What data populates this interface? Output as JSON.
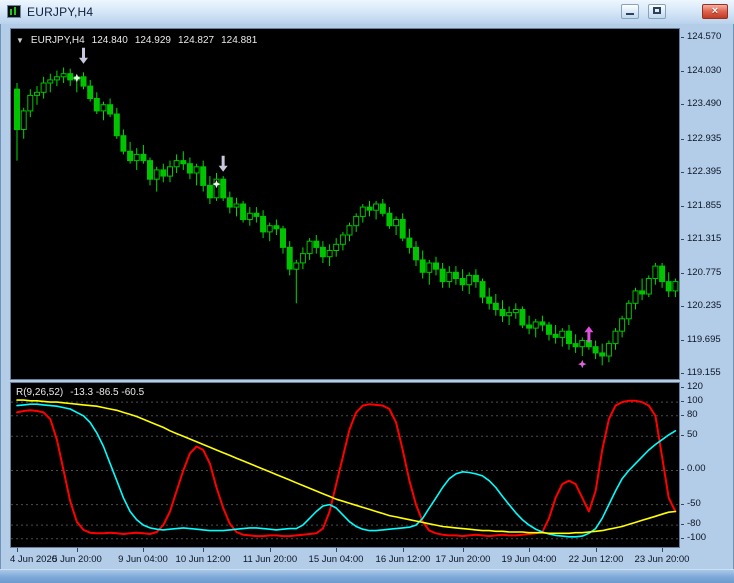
{
  "window": {
    "title": "EURJPY,H4",
    "close_glyph": "×"
  },
  "chart_header": {
    "dropdown_glyph": "▼",
    "symbol": "EURJPY,H4",
    "open": "124.840",
    "high": "124.929",
    "low": "124.827",
    "close": "124.881"
  },
  "indicator_header": {
    "name": "R(9,26,52)",
    "values": "-13.3 -86.5 -60.5"
  },
  "chart_data": [
    {
      "type": "candlestick",
      "symbol": "EURJPY",
      "timeframe": "H4",
      "colors": {
        "body": "#00C400",
        "wick": "#00DC00",
        "background": "#000000"
      },
      "axis": {
        "top_price": 124.72,
        "bottom_price": 119.08,
        "labels": [
          "124.570",
          "124.030",
          "123.490",
          "122.935",
          "122.395",
          "121.855",
          "121.315",
          "120.775",
          "120.235",
          "119.695",
          "119.155"
        ]
      },
      "x_axis": {
        "labels": [
          "4 Jun 2020",
          "5 Jun 20:00",
          "9 Jun 04:00",
          "10 Jun 12:00",
          "11 Jun 20:00",
          "15 Jun 04:00",
          "16 Jun 12:00",
          "17 Jun 20:00",
          "19 Jun 04:00",
          "22 Jun 12:00",
          "23 Jun 20:00"
        ],
        "bars": [
          0,
          9,
          19,
          28,
          38,
          48,
          58,
          67,
          77,
          87,
          97
        ]
      },
      "candles": [
        [
          123.75,
          123.85,
          122.6,
          123.1
        ],
        [
          123.1,
          123.45,
          122.95,
          123.4
        ],
        [
          123.4,
          123.75,
          123.3,
          123.65
        ],
        [
          123.65,
          123.8,
          123.5,
          123.7
        ],
        [
          123.7,
          123.95,
          123.6,
          123.85
        ],
        [
          123.85,
          124.0,
          123.7,
          123.9
        ],
        [
          123.9,
          124.05,
          123.8,
          123.95
        ],
        [
          123.95,
          124.1,
          123.85,
          124.0
        ],
        [
          124.0,
          124.08,
          123.8,
          123.9
        ],
        [
          123.9,
          123.98,
          123.7,
          123.95
        ],
        [
          123.95,
          124.02,
          123.75,
          123.8
        ],
        [
          123.8,
          123.9,
          123.55,
          123.6
        ],
        [
          123.6,
          123.7,
          123.35,
          123.4
        ],
        [
          123.4,
          123.55,
          123.25,
          123.5
        ],
        [
          123.5,
          123.6,
          123.3,
          123.35
        ],
        [
          123.35,
          123.45,
          122.95,
          123.0
        ],
        [
          123.0,
          123.1,
          122.7,
          122.75
        ],
        [
          122.75,
          122.9,
          122.55,
          122.6
        ],
        [
          122.6,
          122.8,
          122.45,
          122.7
        ],
        [
          122.7,
          122.85,
          122.55,
          122.6
        ],
        [
          122.6,
          122.65,
          122.2,
          122.3
        ],
        [
          122.3,
          122.5,
          122.1,
          122.45
        ],
        [
          122.45,
          122.55,
          122.25,
          122.35
        ],
        [
          122.35,
          122.6,
          122.25,
          122.5
        ],
        [
          122.5,
          122.7,
          122.4,
          122.6
        ],
        [
          122.6,
          122.75,
          122.45,
          122.55
        ],
        [
          122.55,
          122.65,
          122.3,
          122.4
        ],
        [
          122.4,
          122.55,
          122.2,
          122.5
        ],
        [
          122.5,
          122.6,
          122.1,
          122.2
        ],
        [
          122.2,
          122.35,
          121.9,
          122.0
        ],
        [
          122.0,
          122.4,
          121.95,
          122.3
        ],
        [
          122.3,
          122.35,
          121.95,
          122.0
        ],
        [
          122.0,
          122.1,
          121.75,
          121.85
        ],
        [
          121.85,
          122.0,
          121.7,
          121.9
        ],
        [
          121.9,
          121.95,
          121.6,
          121.65
        ],
        [
          121.65,
          121.85,
          121.55,
          121.75
        ],
        [
          121.75,
          121.85,
          121.6,
          121.7
        ],
        [
          121.7,
          121.8,
          121.35,
          121.45
        ],
        [
          121.45,
          121.6,
          121.3,
          121.55
        ],
        [
          121.55,
          121.65,
          121.4,
          121.5
        ],
        [
          121.5,
          121.55,
          121.1,
          121.2
        ],
        [
          121.2,
          121.3,
          120.75,
          120.85
        ],
        [
          120.85,
          121.0,
          120.3,
          120.95
        ],
        [
          120.95,
          121.2,
          120.85,
          121.1
        ],
        [
          121.1,
          121.35,
          121.0,
          121.3
        ],
        [
          121.3,
          121.4,
          121.1,
          121.2
        ],
        [
          121.2,
          121.3,
          120.95,
          121.05
        ],
        [
          121.05,
          121.25,
          120.9,
          121.15
        ],
        [
          121.15,
          121.35,
          121.05,
          121.25
        ],
        [
          121.25,
          121.45,
          121.15,
          121.4
        ],
        [
          121.4,
          121.6,
          121.3,
          121.55
        ],
        [
          121.55,
          121.75,
          121.45,
          121.7
        ],
        [
          121.7,
          121.9,
          121.6,
          121.85
        ],
        [
          121.85,
          121.95,
          121.7,
          121.8
        ],
        [
          121.8,
          121.95,
          121.65,
          121.9
        ],
        [
          121.9,
          121.98,
          121.7,
          121.75
        ],
        [
          121.75,
          121.85,
          121.5,
          121.55
        ],
        [
          121.55,
          121.7,
          121.4,
          121.65
        ],
        [
          121.65,
          121.75,
          121.3,
          121.35
        ],
        [
          121.35,
          121.5,
          121.1,
          121.2
        ],
        [
          121.2,
          121.3,
          120.9,
          121.0
        ],
        [
          121.0,
          121.15,
          120.7,
          120.8
        ],
        [
          120.8,
          121.0,
          120.6,
          120.95
        ],
        [
          120.95,
          121.05,
          120.75,
          120.85
        ],
        [
          120.85,
          120.95,
          120.55,
          120.65
        ],
        [
          120.65,
          120.9,
          120.55,
          120.8
        ],
        [
          120.8,
          120.9,
          120.6,
          120.7
        ],
        [
          120.7,
          120.85,
          120.5,
          120.6
        ],
        [
          120.6,
          120.8,
          120.45,
          120.75
        ],
        [
          120.75,
          120.85,
          120.55,
          120.65
        ],
        [
          120.65,
          120.7,
          120.3,
          120.4
        ],
        [
          120.4,
          120.55,
          120.2,
          120.3
        ],
        [
          120.3,
          120.45,
          120.1,
          120.2
        ],
        [
          120.2,
          120.35,
          120.0,
          120.1
        ],
        [
          120.1,
          120.25,
          119.95,
          120.15
        ],
        [
          120.15,
          120.3,
          120.05,
          120.2
        ],
        [
          120.2,
          120.25,
          119.9,
          119.95
        ],
        [
          119.95,
          120.1,
          119.8,
          119.9
        ],
        [
          119.9,
          120.05,
          119.75,
          120.0
        ],
        [
          120.0,
          120.1,
          119.85,
          119.95
        ],
        [
          119.95,
          120.0,
          119.7,
          119.8
        ],
        [
          119.8,
          119.95,
          119.65,
          119.75
        ],
        [
          119.75,
          119.9,
          119.6,
          119.85
        ],
        [
          119.85,
          119.95,
          119.55,
          119.65
        ],
        [
          119.65,
          119.8,
          119.5,
          119.6
        ],
        [
          119.6,
          119.75,
          119.45,
          119.7
        ],
        [
          119.7,
          119.8,
          119.55,
          119.6
        ],
        [
          119.6,
          119.7,
          119.4,
          119.5
        ],
        [
          119.5,
          119.65,
          119.3,
          119.45
        ],
        [
          119.45,
          119.7,
          119.35,
          119.65
        ],
        [
          119.65,
          119.9,
          119.55,
          119.85
        ],
        [
          119.85,
          120.1,
          119.75,
          120.05
        ],
        [
          120.05,
          120.35,
          119.95,
          120.3
        ],
        [
          120.3,
          120.55,
          120.2,
          120.5
        ],
        [
          120.5,
          120.7,
          120.35,
          120.45
        ],
        [
          120.45,
          120.75,
          120.4,
          120.7
        ],
        [
          120.7,
          120.95,
          120.6,
          120.9
        ],
        [
          120.9,
          120.95,
          120.55,
          120.65
        ],
        [
          120.65,
          120.8,
          120.4,
          120.5
        ],
        [
          120.5,
          120.7,
          120.4,
          120.65
        ]
      ],
      "markers": [
        {
          "type": "arrow-down",
          "name": "sell-arrow-icon",
          "bar": 10,
          "price": 124.16,
          "color": "#C6C6DC"
        },
        {
          "type": "star",
          "name": "signal-star-icon",
          "bar": 9,
          "price": 123.93,
          "color": "#F2F2F2"
        },
        {
          "type": "arrow-down",
          "name": "sell-arrow-icon",
          "bar": 31,
          "price": 122.42,
          "color": "#C6C6DC"
        },
        {
          "type": "star",
          "name": "signal-star-icon",
          "bar": 30,
          "price": 122.22,
          "color": "#F2F2F2"
        },
        {
          "type": "arrow-up",
          "name": "buy-arrow-icon",
          "bar": 86,
          "price": 119.93,
          "color": "#E14FE1"
        },
        {
          "type": "star",
          "name": "signal-star-icon",
          "bar": 85,
          "price": 119.32,
          "color": "#DC64DC"
        }
      ]
    },
    {
      "type": "line",
      "name": "R(9,26,52)",
      "current_values": [
        -13.3,
        -86.5,
        -60.5
      ],
      "axis": {
        "top_value": 128,
        "bottom_value": -112,
        "labels": [
          "120",
          "100",
          "80",
          "50",
          "0.00",
          "-50",
          "-80",
          "-100"
        ]
      },
      "levels": [
        100,
        80,
        50,
        0,
        -50,
        -80,
        -100
      ],
      "grid_color": "#4d4d4d",
      "series": [
        {
          "name": "fast-red",
          "color": "#FF0000",
          "width": 2,
          "values": [
            85,
            87,
            88,
            87,
            85,
            75,
            45,
            0,
            -45,
            -75,
            -87,
            -91,
            -92,
            -92,
            -91,
            -92,
            -93,
            -92,
            -91,
            -92,
            -93,
            -90,
            -80,
            -60,
            -30,
            0,
            25,
            35,
            30,
            10,
            -25,
            -55,
            -78,
            -90,
            -94,
            -95,
            -96,
            -96,
            -95,
            -95,
            -96,
            -96,
            -95,
            -94,
            -93,
            -92,
            -85,
            -60,
            -20,
            20,
            60,
            85,
            95,
            97,
            96,
            95,
            90,
            70,
            30,
            -15,
            -50,
            -75,
            -88,
            -92,
            -94,
            -95,
            -95,
            -96,
            -95,
            -94,
            -95,
            -96,
            -95,
            -94,
            -95,
            -95,
            -94,
            -93,
            -92,
            -90,
            -70,
            -40,
            -20,
            -15,
            -20,
            -40,
            -60,
            -30,
            30,
            75,
            95,
            100,
            102,
            102,
            100,
            95,
            80,
            20,
            -40,
            -60
          ]
        },
        {
          "name": "mid-aqua",
          "color": "#00FFFF",
          "width": 1.6,
          "values": [
            95,
            96,
            97,
            97,
            96,
            95,
            94,
            92,
            90,
            85,
            80,
            70,
            55,
            35,
            10,
            -15,
            -40,
            -60,
            -72,
            -80,
            -84,
            -86,
            -87,
            -86,
            -85,
            -84,
            -85,
            -86,
            -87,
            -88,
            -88,
            -88,
            -87,
            -86,
            -85,
            -84,
            -84,
            -85,
            -86,
            -87,
            -86,
            -85,
            -85,
            -80,
            -70,
            -60,
            -52,
            -50,
            -55,
            -65,
            -75,
            -82,
            -86,
            -88,
            -88,
            -87,
            -86,
            -85,
            -84,
            -83,
            -80,
            -70,
            -55,
            -40,
            -25,
            -12,
            -5,
            -2,
            -3,
            -5,
            -8,
            -15,
            -25,
            -38,
            -50,
            -62,
            -72,
            -80,
            -86,
            -90,
            -93,
            -95,
            -96,
            -97,
            -97,
            -96,
            -92,
            -85,
            -70,
            -50,
            -30,
            -12,
            0,
            10,
            20,
            30,
            38,
            45,
            52,
            58
          ]
        },
        {
          "name": "slow-yellow",
          "color": "#FFFF00",
          "width": 1.6,
          "values": [
            103,
            103,
            102,
            102,
            101,
            100,
            100,
            99,
            98,
            97,
            96,
            95,
            94,
            92,
            90,
            88,
            85,
            82,
            79,
            75,
            71,
            67,
            63,
            58,
            54,
            50,
            46,
            42,
            38,
            34,
            30,
            26,
            22,
            18,
            14,
            10,
            6,
            2,
            -2,
            -6,
            -10,
            -14,
            -18,
            -22,
            -26,
            -30,
            -34,
            -38,
            -42,
            -45,
            -48,
            -51,
            -54,
            -57,
            -60,
            -63,
            -66,
            -68,
            -70,
            -72,
            -74,
            -76,
            -78,
            -80,
            -82,
            -83,
            -84,
            -85,
            -86,
            -87,
            -88,
            -88,
            -89,
            -89,
            -90,
            -90,
            -90,
            -91,
            -91,
            -91,
            -92,
            -92,
            -92,
            -92,
            -91,
            -91,
            -90,
            -89,
            -88,
            -86,
            -84,
            -82,
            -79,
            -76,
            -73,
            -70,
            -67,
            -64,
            -61,
            -60
          ]
        }
      ]
    }
  ]
}
